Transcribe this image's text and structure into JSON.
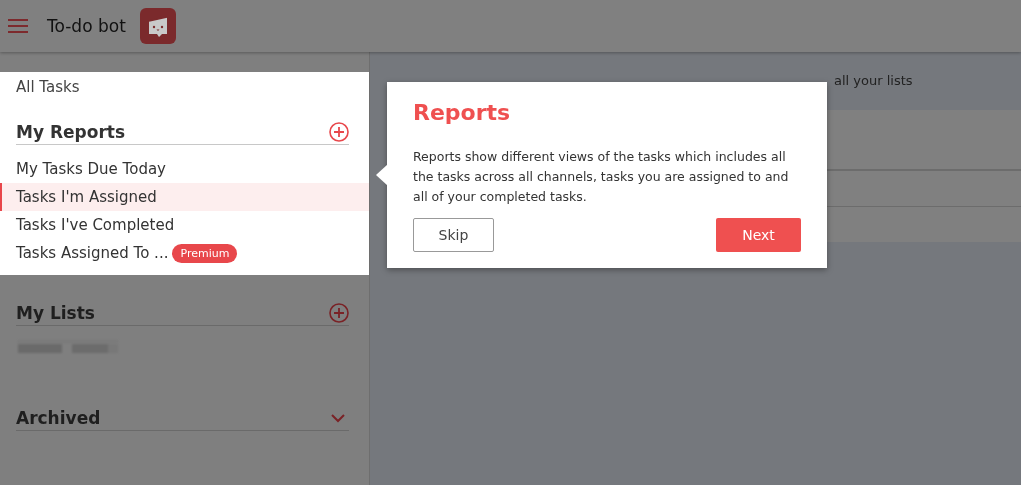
{
  "app": {
    "title": "To-do bot"
  },
  "sidebar": {
    "all_tasks": {
      "label": "All Tasks"
    },
    "reports": {
      "title": "My Reports",
      "items": [
        {
          "label": "My Tasks Due Today",
          "selected": false
        },
        {
          "label": "Tasks I'm Assigned",
          "selected": true
        },
        {
          "label": "Tasks I've Completed",
          "selected": false
        },
        {
          "label": "Tasks Assigned To ...",
          "selected": false,
          "badge": "Premium"
        }
      ]
    },
    "lists": {
      "title": "My Lists"
    },
    "archived": {
      "title": "Archived",
      "expanded": false
    }
  },
  "main": {
    "subtitle": "all your lists"
  },
  "tour": {
    "title": "Reports",
    "text": "Reports show different views of the tasks which includes all the tasks across all channels, tasks you are assigned to and all of your completed tasks.",
    "buttons": [
      {
        "label": "Skip",
        "kind": "secondary"
      },
      {
        "label": "Next",
        "kind": "primary"
      }
    ]
  }
}
